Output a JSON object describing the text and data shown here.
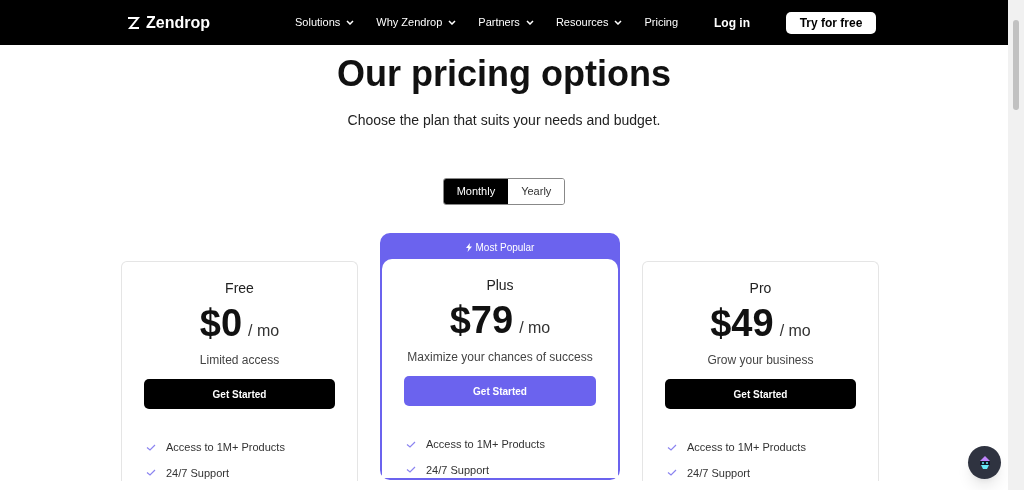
{
  "nav": {
    "brand": "Zendrop",
    "menu": [
      {
        "label": "Solutions",
        "dropdown": true
      },
      {
        "label": "Why Zendrop",
        "dropdown": true
      },
      {
        "label": "Partners",
        "dropdown": true
      },
      {
        "label": "Resources",
        "dropdown": true
      },
      {
        "label": "Pricing",
        "dropdown": false
      }
    ],
    "login": "Log in",
    "cta": "Try for free"
  },
  "heading": "Our pricing options",
  "subheading": "Choose the plan that suits your needs and budget.",
  "billing": [
    {
      "label": "Monthly",
      "selected": true
    },
    {
      "label": "Yearly",
      "selected": false
    }
  ],
  "plans": [
    {
      "name": "Free",
      "price": "$0",
      "unit": "/ mo",
      "description": "Limited access",
      "button": "Get Started",
      "featured": false,
      "features": [
        "Access to 1M+ Products",
        "24/7 Support"
      ]
    },
    {
      "name": "Plus",
      "badge": "Most Popular",
      "price": "$79",
      "unit": "/ mo",
      "description": "Maximize your chances of success",
      "button": "Get Started",
      "featured": true,
      "features": [
        "Access to 1M+ Products",
        "24/7 Support"
      ]
    },
    {
      "name": "Pro",
      "price": "$49",
      "unit": "/ mo",
      "description": "Grow your business",
      "button": "Get Started",
      "featured": false,
      "features": [
        "Access to 1M+ Products",
        "24/7 Support"
      ]
    }
  ]
}
